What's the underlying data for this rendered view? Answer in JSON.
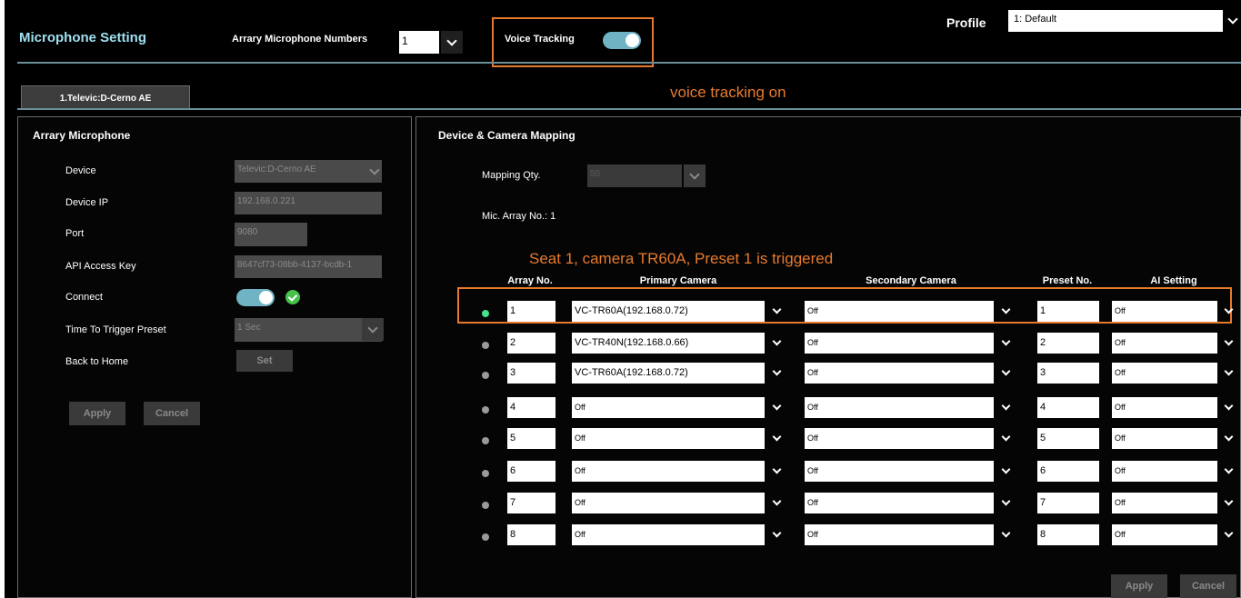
{
  "header": {
    "title": "Microphone Setting",
    "array_numbers_label": "Arrary Microphone Numbers",
    "array_numbers_value": "1",
    "voice_tracking_label": "Voice Tracking",
    "profile_label": "Profile",
    "profile_value": "1: Default"
  },
  "annotations": {
    "voice_tracking_note": "voice tracking on",
    "seat_note": "Seat 1, camera TR60A, Preset 1 is triggered"
  },
  "tab": {
    "label": "1.Televic:D-Cerno AE"
  },
  "left_panel": {
    "title": "Arrary Microphone",
    "device_label": "Device",
    "device_value": "Televic:D-Cerno AE",
    "ip_label": "Device IP",
    "ip_value": "192.168.0.221",
    "port_label": "Port",
    "port_value": "9080",
    "api_label": "API Access Key",
    "api_value": "8647cf73-08bb-4137-bcdb-1",
    "connect_label": "Connect",
    "trigger_label": "Time To Trigger Preset",
    "trigger_value": "1 Sec",
    "home_label": "Back to Home",
    "set_label": "Set",
    "apply_label": "Apply",
    "cancel_label": "Cancel"
  },
  "right_panel": {
    "title": "Device & Camera Mapping",
    "mapping_qty_label": "Mapping Qty.",
    "mapping_qty_value": "50",
    "mic_array_label": "Mic. Array No.: 1",
    "columns": {
      "array_no": "Array No.",
      "primary": "Primary Camera",
      "secondary": "Secondary Camera",
      "preset": "Preset No.",
      "ai": "AI Setting"
    },
    "rows": [
      {
        "array": "1",
        "primary": "VC-TR60A(192.168.0.72)",
        "secondary": "Off",
        "preset": "1",
        "ai": "Off"
      },
      {
        "array": "2",
        "primary": "VC-TR40N(192.168.0.66)",
        "secondary": "Off",
        "preset": "2",
        "ai": "Off"
      },
      {
        "array": "3",
        "primary": "VC-TR60A(192.168.0.72)",
        "secondary": "Off",
        "preset": "3",
        "ai": "Off"
      },
      {
        "array": "4",
        "primary": "Off",
        "secondary": "Off",
        "preset": "4",
        "ai": "Off"
      },
      {
        "array": "5",
        "primary": "Off",
        "secondary": "Off",
        "preset": "5",
        "ai": "Off"
      },
      {
        "array": "6",
        "primary": "Off",
        "secondary": "Off",
        "preset": "6",
        "ai": "Off"
      },
      {
        "array": "7",
        "primary": "Off",
        "secondary": "Off",
        "preset": "7",
        "ai": "Off"
      },
      {
        "array": "8",
        "primary": "Off",
        "secondary": "Off",
        "preset": "8",
        "ai": "Off"
      }
    ],
    "apply_label": "Apply",
    "cancel_label": "Cancel"
  },
  "colors": {
    "accent_title": "#9fe0f0",
    "toggle_on": "#6fb3c4",
    "highlight": "#e87a2c",
    "active_dot": "#44e28c",
    "connected_check": "#45c24a"
  }
}
